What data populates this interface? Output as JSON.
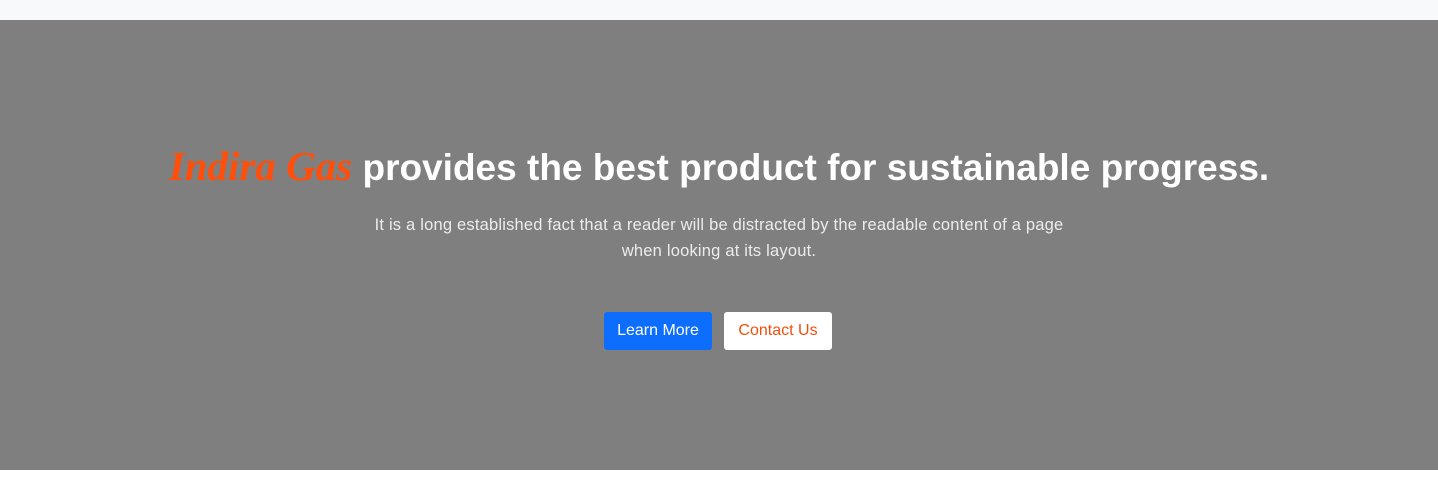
{
  "hero": {
    "brand": "Indira Gas",
    "headline": " provides the best product for sustainable progress.",
    "description": "It is a long established fact that a reader will be distracted by the readable content of a page when looking at its layout.",
    "buttons": {
      "learn_more": "Learn More",
      "contact_us": "Contact Us"
    }
  },
  "colors": {
    "hero_background": "#7f7f7f",
    "brand_accent": "#ff4f0a",
    "primary_button": "#0d6efd",
    "secondary_button_text": "#f04f0e",
    "top_strip": "#f8f9fb"
  }
}
